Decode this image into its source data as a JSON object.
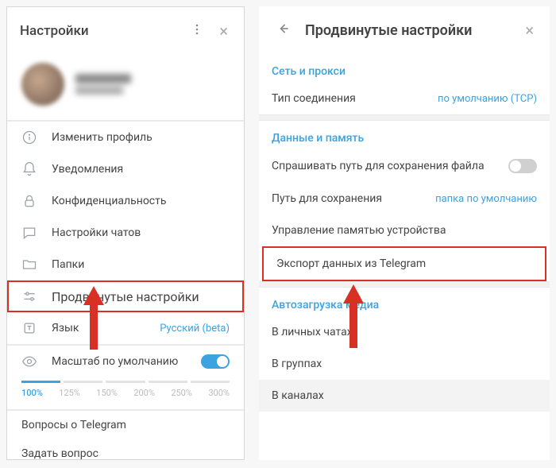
{
  "left": {
    "title": "Настройки",
    "items": {
      "edit_profile": "Изменить профиль",
      "notifications": "Уведомления",
      "privacy": "Конфиденциальность",
      "chat_settings": "Настройки чатов",
      "folders": "Папки",
      "advanced": "Продвинутые настройки",
      "language": "Язык",
      "language_value": "Русский (beta)",
      "scale": "Масштаб по умолчанию",
      "about": "Вопросы о Telegram",
      "ask": "Задать вопрос"
    },
    "zoom": {
      "levels": [
        "100%",
        "125%",
        "150%",
        "200%",
        "250%",
        "300%"
      ],
      "current": "100%"
    }
  },
  "right": {
    "title": "Продвинутые настройки",
    "sections": {
      "network": "Сеть и прокси",
      "connection_type": "Тип соединения",
      "connection_value": "по умолчанию (TCP)",
      "data": "Данные и память",
      "ask_path": "Спрашивать путь для сохранения файла",
      "save_path": "Путь для сохранения",
      "save_path_value": "папка по умолчанию",
      "memory": "Управление памятью устройства",
      "export": "Экспорт данных из Telegram",
      "automedia": "Автозагрузка медиа",
      "private": "В личных чатах",
      "groups": "В группах",
      "channels": "В каналах"
    }
  }
}
